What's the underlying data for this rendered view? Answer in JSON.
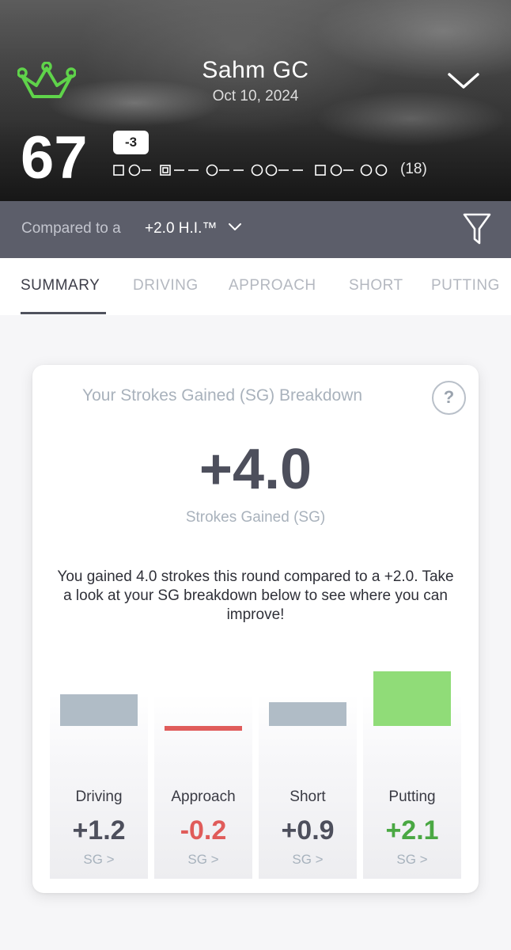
{
  "header": {
    "course_name": "Sahm GC",
    "date": "Oct 10, 2024",
    "score": "67",
    "to_par": "-3",
    "holes_played": "(18)",
    "logo": "crown-logo-icon",
    "collapse_icon": "chevron-down-icon"
  },
  "compare": {
    "label": "Compared to a",
    "value": "+2.0 H.I.™",
    "filter_icon": "filter-icon"
  },
  "tabs": [
    {
      "label": "SUMMARY",
      "active": true
    },
    {
      "label": "DRIVING",
      "active": false
    },
    {
      "label": "APPROACH",
      "active": false
    },
    {
      "label": "SHORT",
      "active": false
    },
    {
      "label": "PUTTING",
      "active": false
    }
  ],
  "card": {
    "title": "Your Strokes Gained (SG) Breakdown",
    "help": "?",
    "total": "+4.0",
    "total_label": "Strokes Gained (SG)",
    "summary": "You gained 4.0 strokes this round compared to a +2.0. Take a look at your SG breakdown below to see where you can improve!"
  },
  "colors": {
    "positive_bar": "#90dc78",
    "neutral_bar": "#b0bcc6",
    "negative_bar": "#e05c5a",
    "positive_text": "#4aa843",
    "negative_text": "#e05c5a",
    "neutral_text": "#4d4f5c"
  },
  "chart_data": {
    "type": "bar",
    "categories": [
      "Driving",
      "Approach",
      "Short",
      "Putting"
    ],
    "values": [
      1.2,
      -0.2,
      0.9,
      2.1
    ],
    "labels": [
      "+1.2",
      "-0.2",
      "+0.9",
      "+2.1"
    ],
    "link_text": [
      "SG >",
      "SG >",
      "SG >",
      "SG >"
    ]
  }
}
